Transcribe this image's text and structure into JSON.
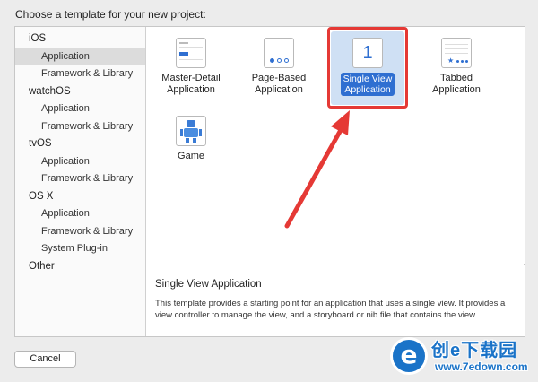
{
  "header": {
    "title": "Choose a template for your new project:"
  },
  "sidebar": {
    "groups": [
      {
        "platform": "iOS",
        "items": [
          "Application",
          "Framework & Library"
        ]
      },
      {
        "platform": "watchOS",
        "items": [
          "Application",
          "Framework & Library"
        ]
      },
      {
        "platform": "tvOS",
        "items": [
          "Application",
          "Framework & Library"
        ]
      },
      {
        "platform": "OS X",
        "items": [
          "Application",
          "Framework & Library",
          "System Plug-in"
        ]
      },
      {
        "platform": "Other",
        "items": []
      }
    ],
    "selected": "iOS / Application"
  },
  "templates": [
    {
      "line1": "Master-Detail",
      "line2": "Application",
      "icon": "master-detail-icon"
    },
    {
      "line1": "Page-Based",
      "line2": "Application",
      "icon": "page-based-icon"
    },
    {
      "line1": "Single View",
      "line2": "Application",
      "icon": "single-view-icon",
      "glyph": "1",
      "selected": true
    },
    {
      "line1": "Tabbed",
      "line2": "Application",
      "icon": "tabbed-icon"
    },
    {
      "line1": "Game",
      "line2": "",
      "icon": "game-robot-icon"
    }
  ],
  "description": {
    "title": "Single View Application",
    "text": "This template provides a starting point for an application that uses a single view. It provides a view controller to manage the view, and a storyboard or nib file that contains the view."
  },
  "footer": {
    "cancel_label": "Cancel"
  },
  "watermark": {
    "logo_letter": "e",
    "brand": "创e下载园",
    "url": "www.7edown.com"
  },
  "colors": {
    "selection_blue": "#2f6fd1",
    "selection_bg": "#cfe0f4",
    "annotation_red": "#e53935"
  }
}
